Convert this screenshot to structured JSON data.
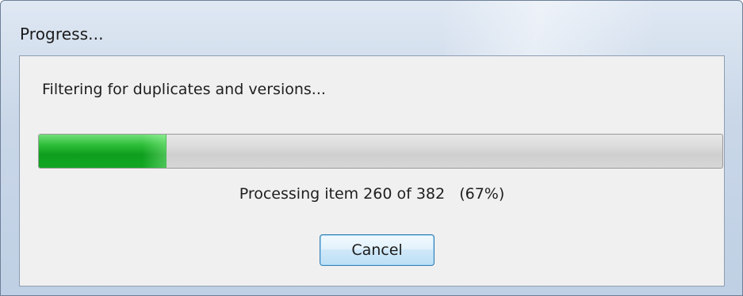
{
  "window": {
    "title": "Progress..."
  },
  "dialog": {
    "message": "Filtering for duplicates and versions...",
    "progress": {
      "fraction": 0.186,
      "fill_color": "#1aa82a",
      "track_color": "#d4d4d4"
    },
    "status_text": "Processing item 260 of 382   (67%)",
    "cancel_label": "Cancel"
  },
  "colors": {
    "accent_border": "#3c7fb1"
  }
}
